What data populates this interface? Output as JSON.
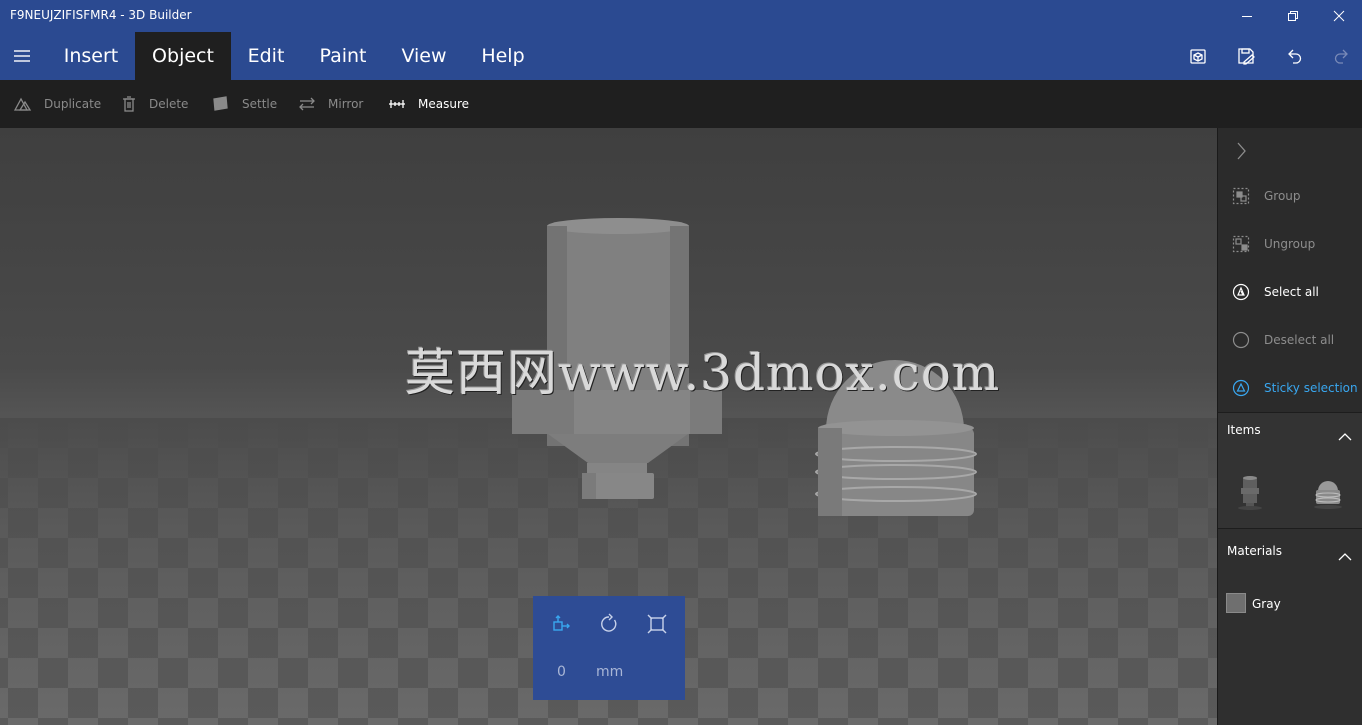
{
  "window": {
    "title": "F9NEUJZIFISFMR4 - 3D Builder"
  },
  "menu": {
    "tabs": [
      {
        "label": "Insert",
        "active": false
      },
      {
        "label": "Object",
        "active": true
      },
      {
        "label": "Edit",
        "active": false
      },
      {
        "label": "Paint",
        "active": false
      },
      {
        "label": "View",
        "active": false
      },
      {
        "label": "Help",
        "active": false
      }
    ],
    "right_icons": [
      "3d-print-icon",
      "save-icon",
      "undo-icon",
      "redo-icon"
    ]
  },
  "toolbar": {
    "items": [
      {
        "label": "Duplicate",
        "icon": "duplicate-icon",
        "enabled": false
      },
      {
        "label": "Delete",
        "icon": "trash-icon",
        "enabled": false
      },
      {
        "label": "Settle",
        "icon": "settle-icon",
        "enabled": false
      },
      {
        "label": "Mirror",
        "icon": "mirror-icon",
        "enabled": false
      },
      {
        "label": "Measure",
        "icon": "measure-icon",
        "enabled": true
      }
    ]
  },
  "viewport": {
    "watermark": "莫西网www.3dmox.com"
  },
  "transform": {
    "icons": [
      "move-icon",
      "rotate-icon",
      "scale-icon"
    ],
    "value": "0",
    "unit": "mm"
  },
  "panel": {
    "actions": [
      {
        "label": "Group",
        "icon": "group-icon",
        "state": "disabled"
      },
      {
        "label": "Ungroup",
        "icon": "ungroup-icon",
        "state": "disabled"
      },
      {
        "label": "Select all",
        "icon": "select-all-icon",
        "state": "enabled"
      },
      {
        "label": "Deselect all",
        "icon": "deselect-all-icon",
        "state": "disabled"
      },
      {
        "label": "Sticky selection",
        "icon": "sticky-selection-icon",
        "state": "accent"
      }
    ],
    "items_title": "Items",
    "materials_title": "Materials",
    "materials": [
      {
        "name": "Gray",
        "color": "#6f6f6f"
      }
    ]
  },
  "colors": {
    "titlebar": "#2b4a91",
    "toolbar": "#1f1f1f",
    "accent": "#39a7f0"
  }
}
